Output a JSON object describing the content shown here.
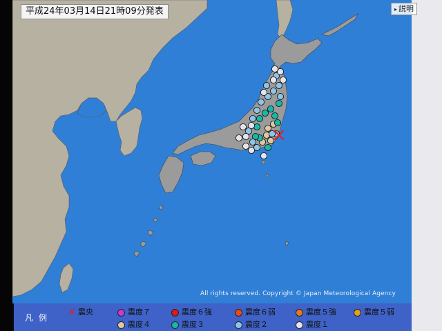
{
  "header": {
    "title": "平成24年03月14日21時09分発表",
    "help_label": "説明"
  },
  "map": {
    "copyright": "All rights reserved. Copyright © Japan Meteorological Agency",
    "sea_color": "#2f7fd6",
    "land_color": "#b7b1a2",
    "japan_color": "#9b9b9b",
    "stations": [
      {
        "intensity": "4"
      },
      {
        "intensity": "4"
      },
      {
        "intensity": "4"
      },
      {
        "intensity": "4"
      },
      {
        "intensity": "4"
      },
      {
        "intensity": "3"
      },
      {
        "intensity": "3"
      },
      {
        "intensity": "3"
      },
      {
        "intensity": "3"
      },
      {
        "intensity": "3"
      },
      {
        "intensity": "3"
      },
      {
        "intensity": "3"
      },
      {
        "intensity": "3"
      },
      {
        "intensity": "3"
      },
      {
        "intensity": "3"
      },
      {
        "intensity": "2"
      },
      {
        "intensity": "2"
      },
      {
        "intensity": "2"
      },
      {
        "intensity": "2"
      },
      {
        "intensity": "2"
      },
      {
        "intensity": "2"
      },
      {
        "intensity": "2"
      },
      {
        "intensity": "2"
      },
      {
        "intensity": "2"
      },
      {
        "intensity": "2"
      },
      {
        "intensity": "2"
      },
      {
        "intensity": "2"
      },
      {
        "intensity": "2"
      },
      {
        "intensity": "2"
      },
      {
        "intensity": "1"
      },
      {
        "intensity": "1"
      },
      {
        "intensity": "1"
      },
      {
        "intensity": "1"
      },
      {
        "intensity": "1"
      },
      {
        "intensity": "1"
      },
      {
        "intensity": "1"
      },
      {
        "intensity": "1"
      },
      {
        "intensity": "1"
      },
      {
        "intensity": "1"
      },
      {
        "intensity": "1"
      },
      {
        "intensity": "1"
      }
    ]
  },
  "legend": {
    "title": "凡例",
    "items": [
      {
        "icon": "epicenter-x-icon",
        "label": "震央",
        "color": "#e02020"
      },
      {
        "icon": "intensity-7-icon",
        "label": "震度７",
        "color": "#c63cd0"
      },
      {
        "icon": "intensity-6-upper-icon",
        "label": "震度６強",
        "color": "#e01818"
      },
      {
        "icon": "intensity-6-lower-icon",
        "label": "震度６弱",
        "color": "#e84a1c"
      },
      {
        "icon": "intensity-5-upper-icon",
        "label": "震度５強",
        "color": "#e8781c"
      },
      {
        "icon": "intensity-5-lower-icon",
        "label": "震度５弱",
        "color": "#e0a020"
      },
      {
        "icon": "intensity-4-icon",
        "label": "震度４",
        "color": "#dcc8a4"
      },
      {
        "icon": "intensity-3-icon",
        "label": "震度３",
        "color": "#18b8a8"
      },
      {
        "icon": "intensity-2-icon",
        "label": "震度２",
        "color": "#8ec4e8"
      },
      {
        "icon": "intensity-1-icon",
        "label": "震度１",
        "color": "#e4e4ee"
      }
    ]
  }
}
